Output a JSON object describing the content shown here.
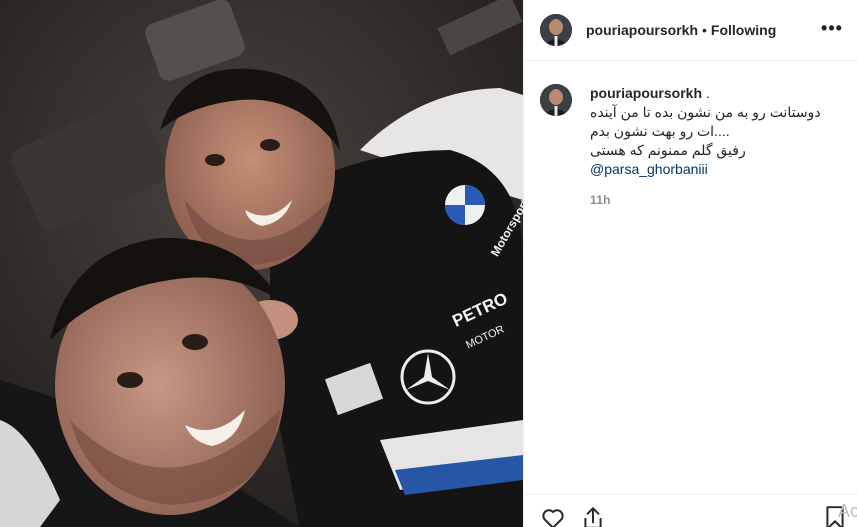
{
  "post": {
    "username": "pouriapoursorkh",
    "separator": "•",
    "follow_status": "Following",
    "more_label": "•••"
  },
  "caption": {
    "username": "pouriapoursorkh",
    "username_suffix": ".",
    "lines": [
      "دوستانت رو به من نشون بده تا من آینده",
      "....ات رو بهت نشون بدم",
      "رفیق گلم ممنونم که هستی"
    ],
    "mention": "@parsa_ghorbaniii",
    "time": "11h"
  },
  "actions": {
    "like_icon": "heart-icon",
    "share_icon": "share-icon",
    "save_icon": "bookmark-icon",
    "overflow_text": "Act"
  },
  "photo": {
    "jersey_texts": [
      "BMW",
      "Motorsport",
      "PETRO",
      "MOTOR"
    ]
  },
  "colors": {
    "link": "#003569",
    "muted": "#8e8e8e",
    "border": "#efefef"
  }
}
